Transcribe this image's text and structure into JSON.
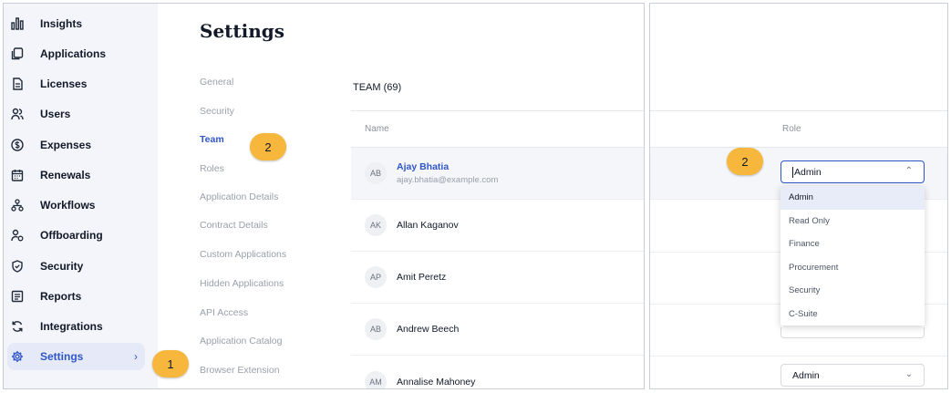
{
  "sidebar": {
    "items": [
      {
        "label": "Insights",
        "icon": "chart-icon"
      },
      {
        "label": "Applications",
        "icon": "copy-icon"
      },
      {
        "label": "Licenses",
        "icon": "document-icon"
      },
      {
        "label": "Users",
        "icon": "users-icon"
      },
      {
        "label": "Expenses",
        "icon": "dollar-icon"
      },
      {
        "label": "Renewals",
        "icon": "calendar-icon"
      },
      {
        "label": "Workflows",
        "icon": "workflow-icon"
      },
      {
        "label": "Offboarding",
        "icon": "user-remove-icon"
      },
      {
        "label": "Security",
        "icon": "shield-icon"
      },
      {
        "label": "Reports",
        "icon": "report-icon"
      },
      {
        "label": "Integrations",
        "icon": "sync-icon"
      },
      {
        "label": "Settings",
        "icon": "gear-icon",
        "active": true
      }
    ],
    "chevron": "›"
  },
  "page": {
    "title": "Settings"
  },
  "settings_menu": [
    {
      "label": "General"
    },
    {
      "label": "Security"
    },
    {
      "label": "Team",
      "active": true
    },
    {
      "label": "Roles"
    },
    {
      "label": "Application Details"
    },
    {
      "label": "Contract Details"
    },
    {
      "label": "Custom Applications"
    },
    {
      "label": "Hidden Applications"
    },
    {
      "label": "API Access"
    },
    {
      "label": "Application Catalog"
    },
    {
      "label": "Browser Extension"
    }
  ],
  "team": {
    "heading": "TEAM (69)",
    "name_column": "Name",
    "role_column": "Role",
    "members": [
      {
        "initials": "AB",
        "name": "Ajay Bhatia",
        "email": "ajay.bhatia@example.com"
      },
      {
        "initials": "AK",
        "name": "Allan Kaganov"
      },
      {
        "initials": "AP",
        "name": "Amit Peretz"
      },
      {
        "initials": "AB",
        "name": "Andrew Beech"
      },
      {
        "initials": "AM",
        "name": "Annalise Mahoney"
      }
    ]
  },
  "role_select": {
    "value": "Admin",
    "open_caret": "⌃",
    "closed_caret": "⌄",
    "options": [
      "Admin",
      "Read Only",
      "Finance",
      "Procurement",
      "Security",
      "C-Suite"
    ],
    "bottom_value": "Admin"
  },
  "callouts": {
    "step1": "1",
    "step2": "2",
    "step2_right": "2"
  },
  "colors": {
    "accent": "#2f56c8",
    "callout": "#f6b73c",
    "sidebar_bg": "#f4f5fb"
  }
}
